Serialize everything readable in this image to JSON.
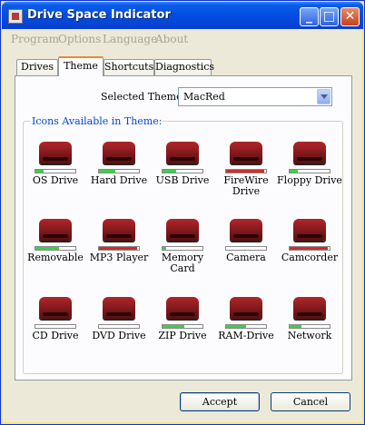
{
  "window": {
    "title": "Drive Space Indicator"
  },
  "menu": [
    "Program",
    "Options",
    "Language",
    "About"
  ],
  "tabs": [
    "Drives",
    "Theme",
    "Shortcuts",
    "Diagnostics"
  ],
  "active_tab": "Theme",
  "theme": {
    "label": "Selected Theme:",
    "value": "MacRed"
  },
  "group": {
    "label": "Icons Available in Theme:"
  },
  "icons": [
    {
      "label": "OS Drive",
      "icon": "os-drive-icon",
      "fill": 0.2,
      "color": "#3ad24a"
    },
    {
      "label": "Hard Drive",
      "icon": "hard-drive-icon",
      "fill": 0.4,
      "color": "#3ad24a"
    },
    {
      "label": "USB Drive",
      "icon": "usb-drive-icon",
      "fill": 0.35,
      "color": "#3ad24a"
    },
    {
      "label": "FireWire Drive",
      "icon": "firewire-drive-icon",
      "fill": 0.95,
      "color": "#d42a2a"
    },
    {
      "label": "Floppy Drive",
      "icon": "floppy-drive-icon",
      "fill": 0.2,
      "color": "#3ad24a"
    },
    {
      "label": "Removable",
      "icon": "removable-drive-icon",
      "fill": 0.6,
      "color": "#3ad24a"
    },
    {
      "label": "MP3 Player",
      "icon": "mp3-player-icon",
      "fill": 0.95,
      "color": "#d42a2a"
    },
    {
      "label": "Memory Card",
      "icon": "memory-card-icon",
      "fill": 0.08,
      "color": "#3ad24a"
    },
    {
      "label": "Camera",
      "icon": "camera-icon",
      "fill": 0.0,
      "color": "#3ad24a"
    },
    {
      "label": "Camcorder",
      "icon": "camcorder-icon",
      "fill": 0.95,
      "color": "#d42a2a"
    },
    {
      "label": "CD Drive",
      "icon": "cd-drive-icon",
      "fill": 0.0,
      "color": "#3ad24a"
    },
    {
      "label": "DVD Drive",
      "icon": "dvd-drive-icon",
      "fill": 0.0,
      "color": "#3ad24a"
    },
    {
      "label": "ZIP Drive",
      "icon": "zip-drive-icon",
      "fill": 0.55,
      "color": "#3ad24a"
    },
    {
      "label": "RAM-Drive",
      "icon": "ram-drive-icon",
      "fill": 0.5,
      "color": "#3ad24a"
    },
    {
      "label": "Network",
      "icon": "network-drive-icon",
      "fill": 0.3,
      "color": "#3ad24a"
    }
  ],
  "buttons": {
    "accept": "Accept",
    "cancel": "Cancel"
  },
  "titlebar_buttons": {
    "minimize": "_",
    "maximize": "□",
    "close": "✕"
  }
}
